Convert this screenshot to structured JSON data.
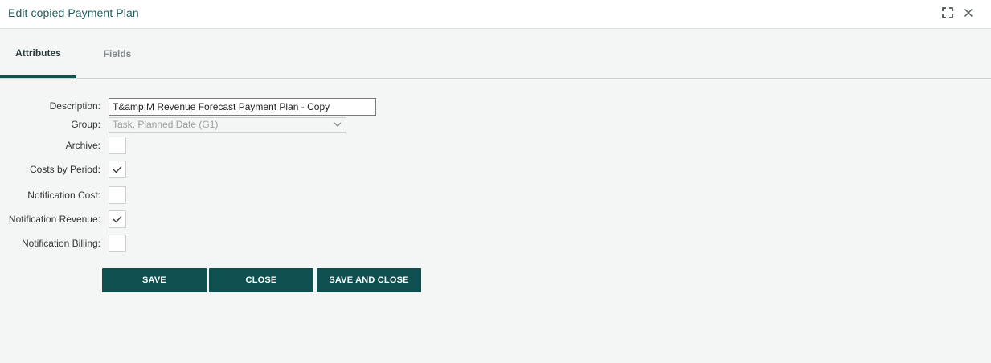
{
  "dialog": {
    "title": "Edit copied Payment Plan",
    "expand_icon": "expand-icon",
    "close_icon": "close-icon"
  },
  "tabs": [
    {
      "label": "Attributes",
      "active": true
    },
    {
      "label": "Fields",
      "active": false
    }
  ],
  "form": {
    "description": {
      "label": "Description:",
      "value": "T&amp;M Revenue Forecast Payment Plan - Copy"
    },
    "group": {
      "label": "Group:",
      "value": "Task, Planned Date (G1)"
    },
    "archive": {
      "label": "Archive:",
      "checked": false
    },
    "costs_by_period": {
      "label": "Costs by Period:",
      "checked": true
    },
    "notification_cost": {
      "label": "Notification Cost:",
      "checked": false
    },
    "notification_revenue": {
      "label": "Notification Revenue:",
      "checked": true
    },
    "notification_billing": {
      "label": "Notification Billing:",
      "checked": false
    }
  },
  "buttons": {
    "save": "SAVE",
    "close": "CLOSE",
    "save_and_close": "SAVE AND CLOSE"
  },
  "colors": {
    "accent": "#0e4f4f",
    "title": "#1f5c5c",
    "background": "#f4f6f5"
  }
}
